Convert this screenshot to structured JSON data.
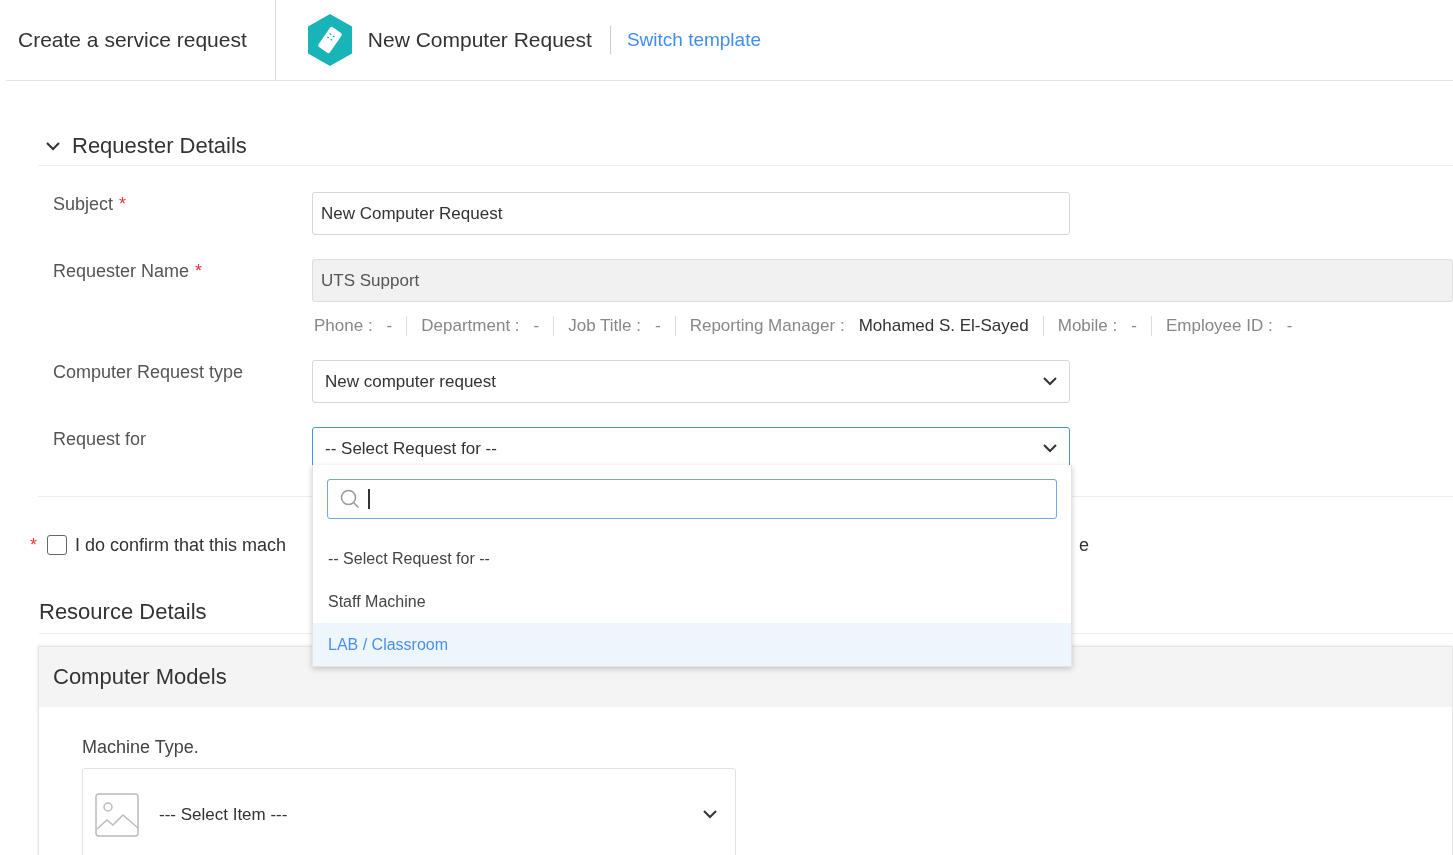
{
  "header": {
    "title": "Create a service request",
    "template_name": "New Computer Request",
    "switch_link": "Switch template"
  },
  "requester_section": {
    "title": "Requester Details",
    "expanded": true,
    "fields": [
      {
        "kind": "text",
        "label": "Subject",
        "required_mark": "*",
        "value": "New Computer Request"
      },
      {
        "kind": "readonly",
        "label": "Requester Name",
        "required_mark": "*",
        "value": "UTS Support",
        "info": [
          {
            "label": "Phone :",
            "value": "-"
          },
          {
            "label": "Department :",
            "value": "-"
          },
          {
            "label": "Job Title :",
            "value": "-"
          },
          {
            "label": "Reporting Manager :",
            "value": "Mohamed S. El-Sayed"
          },
          {
            "label": "Mobile :",
            "value": "-"
          },
          {
            "label": "Employee ID :",
            "value": "-"
          }
        ]
      },
      {
        "kind": "select",
        "label": "Computer Request type",
        "value": "New computer request",
        "focused": false
      },
      {
        "kind": "select",
        "label": "Request for",
        "value": "-- Select Request for --",
        "focused": true
      }
    ]
  },
  "dropdown": {
    "options": [
      {
        "label": "-- Select Request for --",
        "selected": false
      },
      {
        "label": "Staff Machine",
        "selected": false
      },
      {
        "label": "LAB / Classroom",
        "selected": true
      }
    ]
  },
  "confirm": {
    "required_mark": "*",
    "checked": false,
    "label": "I do confirm that this mach",
    "label_end": "e"
  },
  "resource_section": {
    "title": "Resource Details",
    "panel_title": "Computer Models",
    "field_label": "Machine Type.",
    "select_placeholder": "--- Select Item ---"
  }
}
